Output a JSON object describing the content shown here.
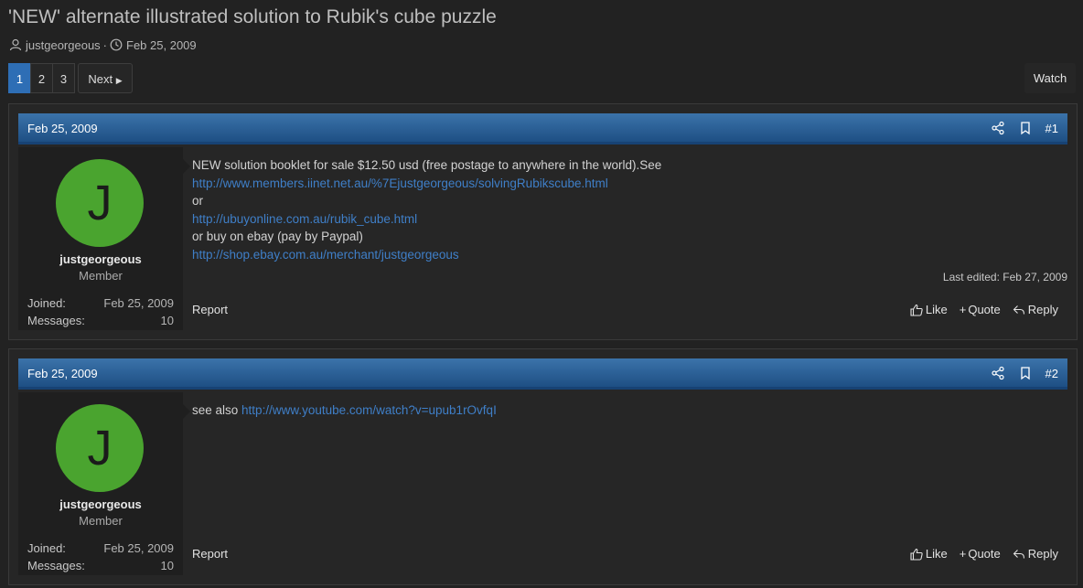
{
  "thread": {
    "title": "'NEW' alternate illustrated solution to Rubik's cube puzzle",
    "author": "justgeorgeous",
    "separator": "·",
    "date": "Feb 25, 2009"
  },
  "pagination": {
    "pages": [
      "1",
      "2",
      "3"
    ],
    "current": "1",
    "next_label": "Next"
  },
  "watch_label": "Watch",
  "posts": [
    {
      "date": "Feb 25, 2009",
      "number": "#1",
      "user": {
        "initial": "J",
        "name": "justgeorgeous",
        "role": "Member",
        "joined_label": "Joined:",
        "joined": "Feb 25, 2009",
        "messages_label": "Messages:",
        "messages": "10"
      },
      "lines": [
        {
          "text": "NEW solution booklet for sale $12.50 usd (free postage to anywhere in the world).See",
          "link": false
        },
        {
          "text": "http://www.members.iinet.net.au/%7Ejustgeorgeous/solvingRubikscube.html",
          "link": true
        },
        {
          "text": "or",
          "link": false
        },
        {
          "text": "http://ubuyonline.com.au/rubik_cube.html",
          "link": true
        },
        {
          "text": "or buy on ebay (pay by Paypal)",
          "link": false
        },
        {
          "text": "http://shop.ebay.com.au/merchant/justgeorgeous",
          "link": true
        }
      ],
      "last_edited": "Last edited: Feb 27, 2009",
      "report": "Report",
      "actions": {
        "like": "Like",
        "quote": "Quote",
        "reply": "Reply"
      }
    },
    {
      "date": "Feb 25, 2009",
      "number": "#2",
      "user": {
        "initial": "J",
        "name": "justgeorgeous",
        "role": "Member",
        "joined_label": "Joined:",
        "joined": "Feb 25, 2009",
        "messages_label": "Messages:",
        "messages": "10"
      },
      "text_prefix": "see also ",
      "link": "http://www.youtube.com/watch?v=upub1rOvfqI",
      "report": "Report",
      "actions": {
        "like": "Like",
        "quote": "Quote",
        "reply": "Reply"
      }
    }
  ]
}
